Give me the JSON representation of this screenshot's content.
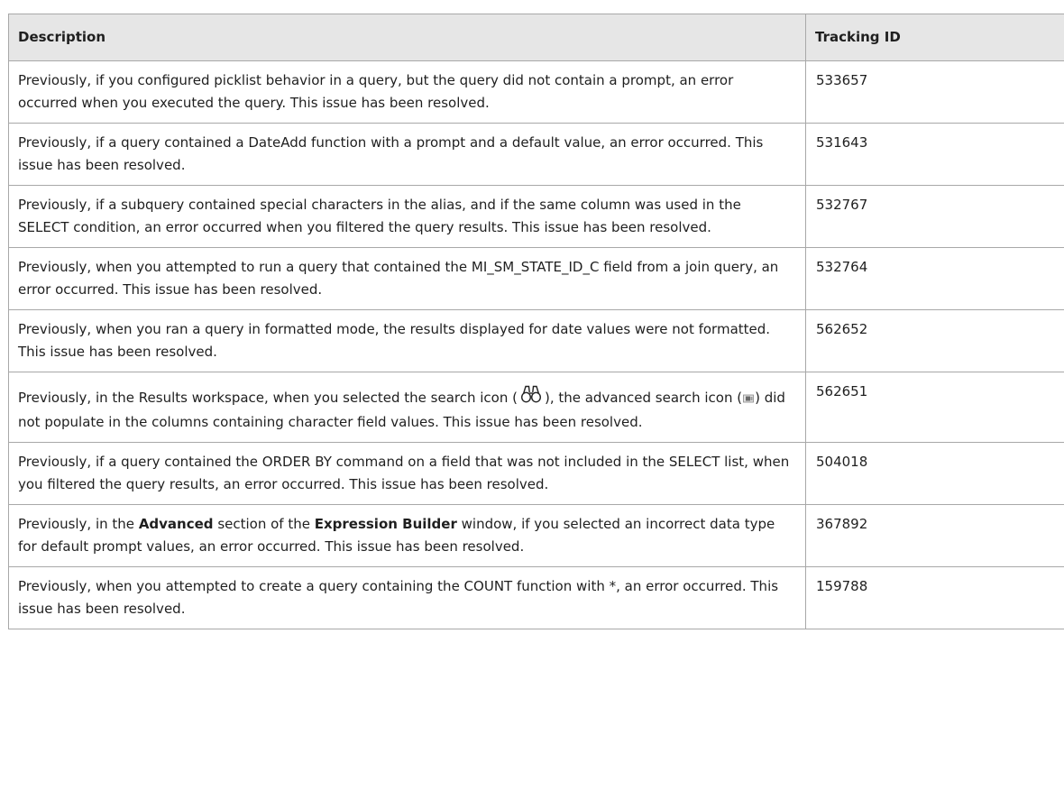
{
  "table": {
    "headers": {
      "description": "Description",
      "tracking_id": "Tracking ID"
    },
    "rows": [
      {
        "description": "Previously, if you configured picklist behavior in a query, but the query did not contain a prompt, an error occurred when you executed the query. This issue has been resolved.",
        "tracking_id": "533657"
      },
      {
        "description": "Previously, if a query contained a DateAdd function with a prompt and a default value, an error occurred. This issue has been resolved.",
        "tracking_id": "531643"
      },
      {
        "description": "Previously, if a subquery contained special characters in the alias, and if the same column was used in the SELECT condition, an error occurred when you filtered the query results. This issue has been resolved.",
        "tracking_id": "532767"
      },
      {
        "description": "Previously, when you attempted to run a query that contained the MI_SM_STATE_ID_C field from a join query, an error occurred. This issue has been resolved.",
        "tracking_id": "532764"
      },
      {
        "description": "Previously, when you ran a query in formatted mode, the results displayed for date values were not formatted. This issue has been resolved.",
        "tracking_id": "562652"
      },
      {
        "description_parts": {
          "p1": "Previously, in the Results workspace, when you selected the search icon (",
          "p2": "), the advanced search icon (",
          "p3": ") did not populate in the columns containing character field values. This issue has been resolved."
        },
        "icons": [
          "binoculars-search-icon",
          "advanced-search-icon"
        ],
        "tracking_id": "562651"
      },
      {
        "description": "Previously, if a query contained the ORDER BY command on a field that was not included in the SELECT list, when you filtered the query results, an error occurred. This issue has been resolved.",
        "tracking_id": "504018"
      },
      {
        "description_parts": {
          "p1": "Previously, in the ",
          "b1": "Advanced",
          "p2": " section of the ",
          "b2": "Expression Builder",
          "p3": " window, if you selected an incorrect data type for default prompt values, an error occurred. This issue has been resolved."
        },
        "tracking_id": "367892"
      },
      {
        "description": "Previously, when you attempted to create a query containing the COUNT function with *, an error occurred. This issue has been resolved.",
        "tracking_id": "159788"
      }
    ]
  }
}
